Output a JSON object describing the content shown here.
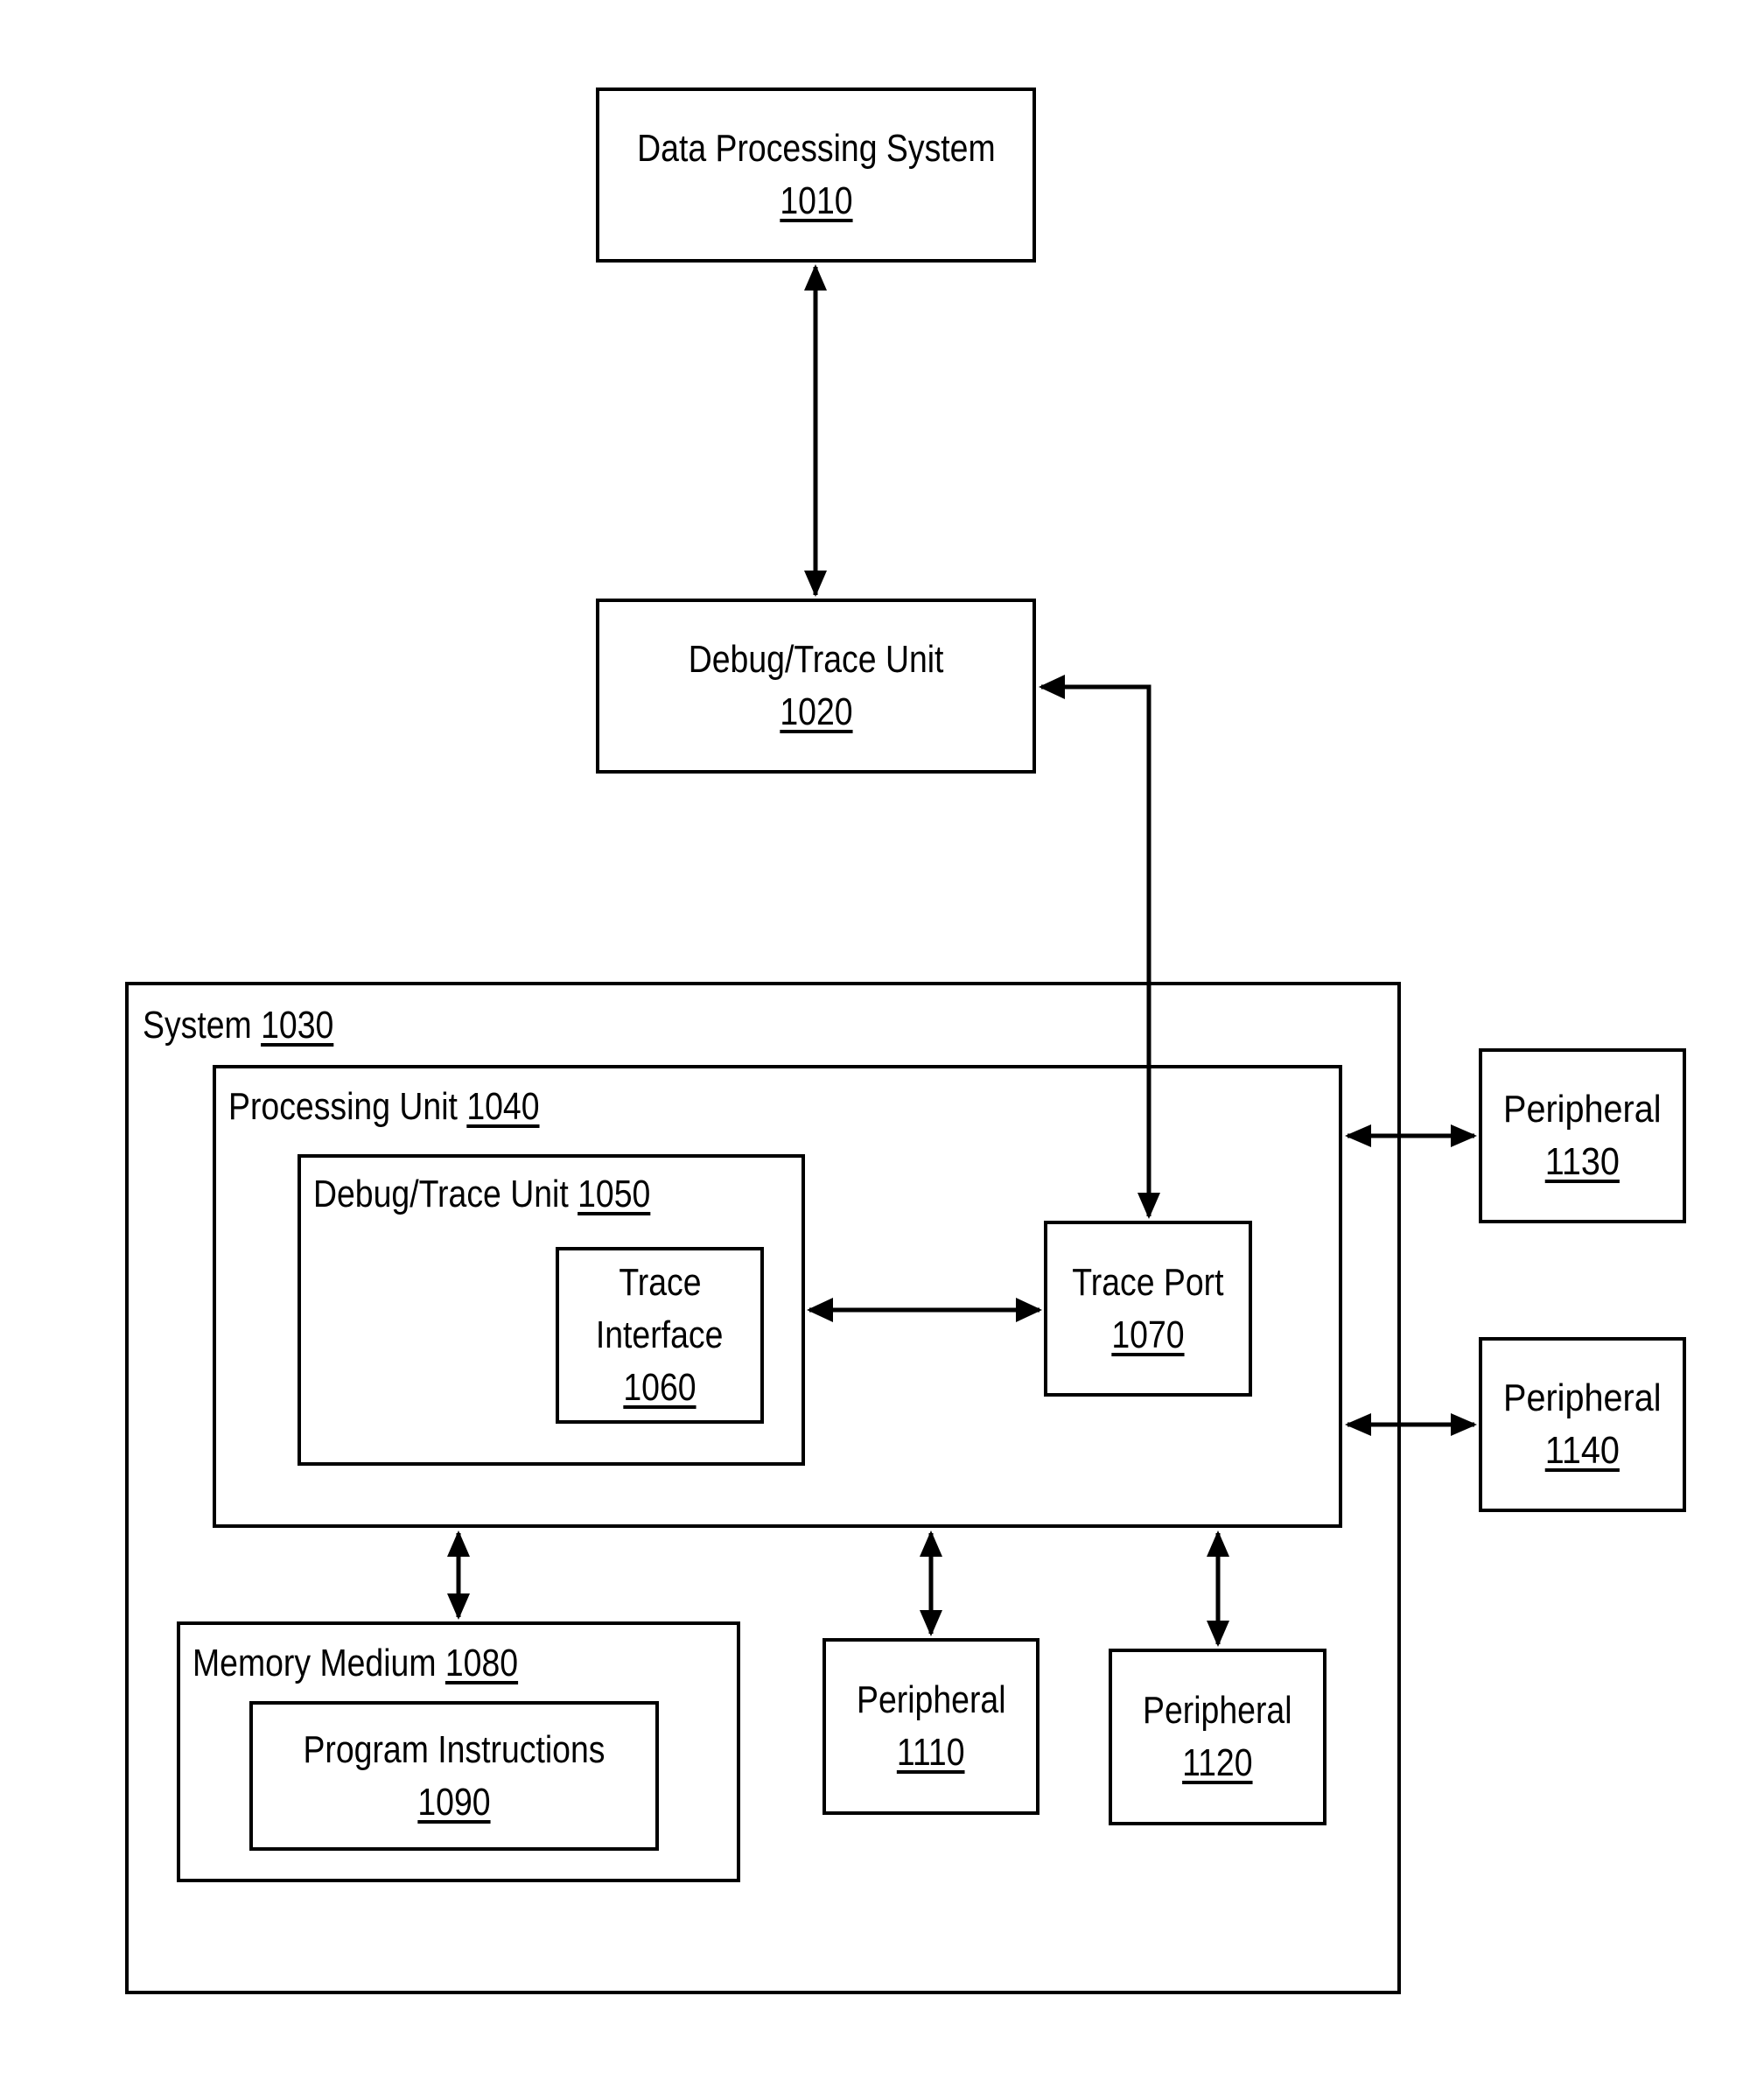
{
  "diagram": {
    "nodes": {
      "dps": {
        "label": "Data Processing System",
        "ref": "1010"
      },
      "debug_ext": {
        "label": "Debug/Trace Unit",
        "ref": "1020"
      },
      "system": {
        "label": "System",
        "ref": "1030"
      },
      "processing_unit": {
        "label": "Processing Unit",
        "ref": "1040"
      },
      "debug_int": {
        "label": "Debug/Trace Unit",
        "ref": "1050"
      },
      "trace_interface": {
        "label_line1": "Trace",
        "label_line2": "Interface",
        "ref": "1060"
      },
      "trace_port": {
        "label": "Trace Port",
        "ref": "1070"
      },
      "memory": {
        "label": "Memory Medium",
        "ref": "1080"
      },
      "program": {
        "label": "Program Instructions",
        "ref": "1090"
      },
      "p1110": {
        "label": "Peripheral",
        "ref": "1110"
      },
      "p1120": {
        "label": "Peripheral",
        "ref": "1120"
      },
      "p1130": {
        "label": "Peripheral",
        "ref": "1130"
      },
      "p1140": {
        "label": "Peripheral",
        "ref": "1140"
      }
    },
    "edges": [
      {
        "from": "1010",
        "to": "1020",
        "direction": "bidirectional"
      },
      {
        "from": "1020",
        "to": "1070",
        "direction": "bidirectional"
      },
      {
        "from": "1060",
        "to": "1070",
        "direction": "bidirectional"
      },
      {
        "from": "1040",
        "to": "1080",
        "direction": "bidirectional"
      },
      {
        "from": "1040",
        "to": "1110",
        "direction": "bidirectional"
      },
      {
        "from": "1040",
        "to": "1120",
        "direction": "bidirectional"
      },
      {
        "from": "1040",
        "to": "1130",
        "direction": "bidirectional"
      },
      {
        "from": "1040",
        "to": "1140",
        "direction": "bidirectional"
      }
    ]
  }
}
